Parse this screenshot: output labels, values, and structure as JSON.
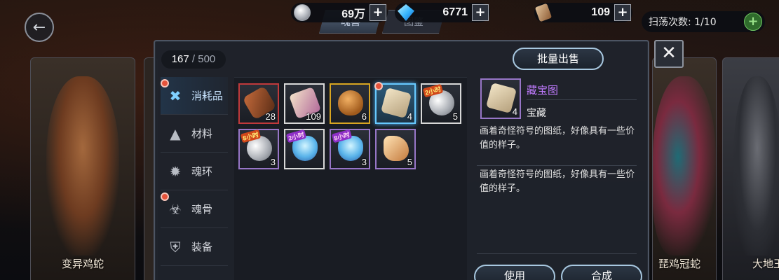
{
  "resources": {
    "silver": "69万",
    "gems": "6771",
    "scroll_count": "109",
    "sweep": "扫荡次数: 1/10"
  },
  "top_tabs": [
    {
      "label": "魂兽"
    },
    {
      "label": "图鉴"
    }
  ],
  "cards": {
    "left": "变异鸡蛇",
    "right": "琵鸡冠蛇",
    "right2": "大地王"
  },
  "panel": {
    "capacity_used": "167",
    "capacity_sep": " / ",
    "capacity_max": "500",
    "bulk_sell": "批量出售",
    "close": "✕"
  },
  "categories": [
    {
      "label": "消耗品",
      "icon": "tools-icon"
    },
    {
      "label": "材料",
      "icon": "anvil-icon"
    },
    {
      "label": "魂环",
      "icon": "soul-ring-icon"
    },
    {
      "label": "魂骨",
      "icon": "soul-bone-icon"
    },
    {
      "label": "装备",
      "icon": "equipment-icon"
    }
  ],
  "items": [
    {
      "qty": "28",
      "icon": "rod-icon"
    },
    {
      "qty": "109",
      "icon": "scroll-icon"
    },
    {
      "qty": "6",
      "icon": "egg-icon"
    },
    {
      "qty": "4",
      "icon": "treasure-map-icon"
    },
    {
      "qty": "5",
      "icon": "silver-coins-icon",
      "tag": "2小时"
    },
    {
      "qty": "3",
      "icon": "silver-coins-icon",
      "tag": "8小时"
    },
    {
      "qty": "",
      "icon": "potion-icon",
      "tag": "2小时"
    },
    {
      "qty": "3",
      "icon": "potion-icon",
      "tag": "8小时"
    },
    {
      "qty": "5",
      "icon": "horn-icon"
    }
  ],
  "detail": {
    "qty": "4",
    "name": "藏宝图",
    "type": "宝藏",
    "desc1": "画着奇怪符号的图纸，好像具有一些价值的样子。",
    "desc2": "画着奇怪符号的图纸，好像具有一些价值的样子。",
    "use_button": "使用",
    "combine_button": "合成"
  },
  "colors": {
    "accent_blue": "#67c9ff",
    "rarity_purple": "#9776c7",
    "name_purple": "#c07bff",
    "red_dot": "#e5533b"
  }
}
